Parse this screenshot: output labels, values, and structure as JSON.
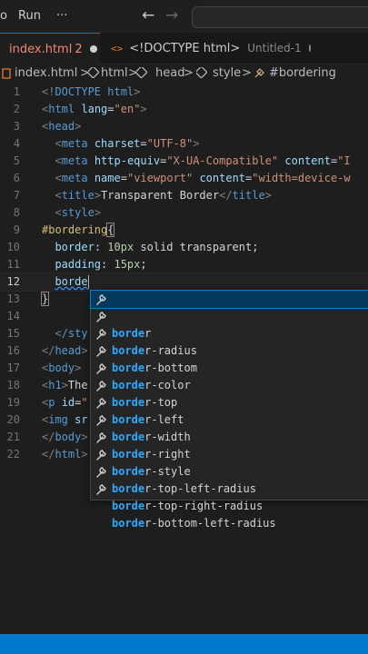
{
  "titlebar": {
    "menu_left": "o",
    "menu_run": "Run",
    "menu_more": "···",
    "back_arrow": "←",
    "forward_arrow": "→"
  },
  "tabs": [
    {
      "label": "index.html",
      "count": "2"
    },
    {
      "icon": "<>",
      "label": "<!DOCTYPE html>",
      "sub": "Untitled-1"
    }
  ],
  "breadcrumb": {
    "file": "index.html",
    "sep": ">",
    "items": [
      "html",
      "head",
      "style",
      "#bordering"
    ]
  },
  "editor": {
    "line_numbers": [
      "1",
      "2",
      "3",
      "4",
      "5",
      "6",
      "7",
      "8",
      "9",
      "10",
      "11",
      "12",
      "13",
      "14",
      "15",
      "16",
      "17",
      "18",
      "19",
      "20",
      "21",
      "22"
    ],
    "lines": {
      "l1": "DOCTYPE html",
      "l2_attr": "lang",
      "l2_val": "\"en\"",
      "l4_attr": "charset",
      "l4_val": "\"UTF-8\"",
      "l5_attr": "http-equiv",
      "l5_val": "\"X-UA-Compatible\"",
      "l5_attr2": "content",
      "l5_val2": "\"I",
      "l6_attr": "name",
      "l6_val": "\"viewport\"",
      "l6_attr2": "content",
      "l6_val2": "\"width=device-w",
      "l7_text": "Transparent Border",
      "l9_sel": "#bordering",
      "l10_prop": "border",
      "l10_val": "10px solid transparent;",
      "l10_num": "10px",
      "l10_rest": "solid transparent;",
      "l11_prop": "padding",
      "l11_num": "15px",
      "l11_semi": ";",
      "l12_typed": "borde",
      "l15_end": "/sty",
      "l18_text": "The",
      "l19_attr": "id",
      "l20_attr": "sr"
    }
  },
  "suggestions": {
    "prefix": "borde",
    "items": [
      "border",
      "border-radius",
      "border-bottom",
      "border-color",
      "border-top",
      "border-left",
      "border-width",
      "border-right",
      "border-style",
      "border-top-left-radius",
      "border-top-right-radius",
      "border-bottom-left-radius"
    ],
    "selected_index": 0
  },
  "colors": {
    "accent": "#007acc",
    "tab_modified": "#f48771",
    "suggest_match": "#2aaaff",
    "suggest_selected": "#04395e"
  }
}
